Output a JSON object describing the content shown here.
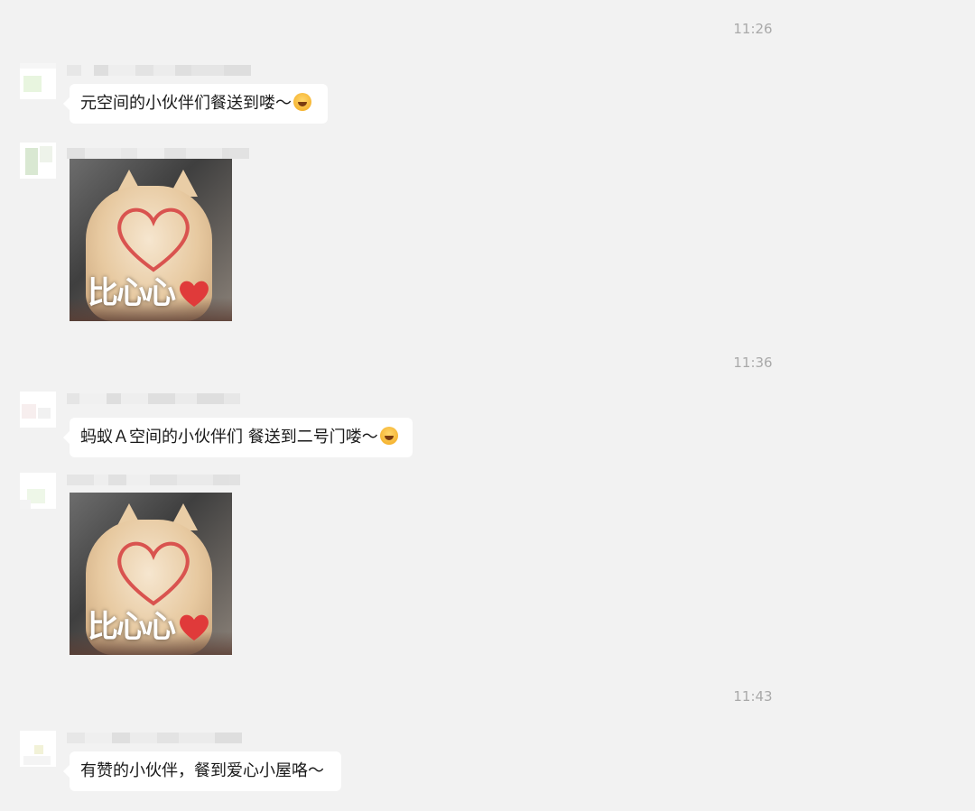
{
  "timestamps": [
    "11:26",
    "11:36",
    "11:43"
  ],
  "messages": [
    {
      "type": "text",
      "text": "元空间的小伙伴们餐送到喽～",
      "emoji": "grinning-face-icon"
    },
    {
      "type": "sticker",
      "sticker_text": "比心心"
    },
    {
      "type": "text",
      "text": "蚂蚁Ａ空间的小伙伴们 餐送到二号门喽～",
      "emoji": "grinning-face-icon"
    },
    {
      "type": "sticker",
      "sticker_text": "比心心"
    },
    {
      "type": "text",
      "text": "有赞的小伙伴，餐到爱心小屋咯～"
    }
  ],
  "colors": {
    "background": "#f2f2f2",
    "bubble": "#ffffff",
    "timestamp": "#a9a9a9"
  }
}
